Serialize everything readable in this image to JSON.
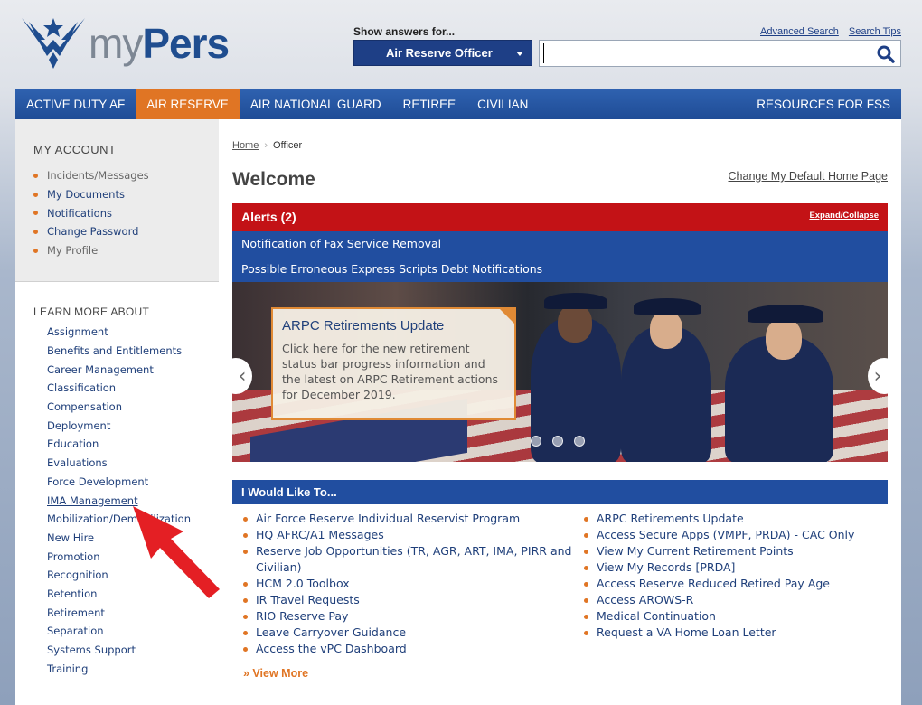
{
  "header": {
    "logo_my": "my",
    "logo_pers": "Pers",
    "show_answers_label": "Show answers for...",
    "role_selected": "Air Reserve Officer",
    "search_value": "",
    "links": [
      "Advanced Search",
      "Search Tips"
    ]
  },
  "nav": {
    "items": [
      "ACTIVE DUTY AF",
      "AIR RESERVE",
      "AIR NATIONAL GUARD",
      "RETIREE",
      "CIVILIAN"
    ],
    "active": "AIR RESERVE",
    "right_item": "RESOURCES FOR FSS",
    "active_color": "#e07524"
  },
  "sidebar": {
    "account_title": "MY ACCOUNT",
    "account_items": [
      "Incidents/Messages",
      "My Documents",
      "Notifications",
      "Change Password",
      "My Profile"
    ],
    "learn_title": "LEARN MORE ABOUT",
    "learn_items": [
      "Assignment",
      "Benefits and Entitlements",
      "Career Management",
      "Classification",
      "Compensation",
      "Deployment",
      "Education",
      "Evaluations",
      "Force Development",
      "IMA Management",
      "Mobilization/Demobilization",
      "New Hire",
      "Promotion",
      "Recognition",
      "Retention",
      "Retirement",
      "Separation",
      "Systems Support",
      "Training"
    ]
  },
  "main": {
    "breadcrumb_home": "Home",
    "breadcrumb_current": "Officer",
    "title": "Welcome",
    "change_home": "Change My Default Home Page",
    "alerts_title": "Alerts (2)",
    "alerts_toggle": "Expand/Collapse",
    "alerts": [
      "Notification of Fax Service Removal",
      "Possible Erroneous Express Scripts Debt Notifications"
    ],
    "carousel": {
      "title": "ARPC Retirements  Update",
      "body": "Click here for the new retirement status bar progress information and the latest on ARPC Retirement actions for December 2019.",
      "prev_icon": "chevron-left-icon",
      "next_icon": "chevron-right-icon",
      "dots": 3
    },
    "iwlt_title": "I Would Like To...",
    "iwlt_left": [
      "Air Force Reserve Individual Reservist Program",
      "HQ AFRC/A1 Messages",
      "Reserve Job Opportunities (TR, AGR, ART, IMA, PIRR and Civilian)",
      "HCM 2.0 Toolbox",
      "IR Travel Requests",
      "RIO Reserve Pay",
      "Leave Carryover Guidance",
      "Access the vPC Dashboard"
    ],
    "iwlt_right": [
      "ARPC Retirements Update",
      "Access Secure Apps (VMPF, PRDA) - CAC Only",
      "View My Current Retirement Points",
      "View My Records [PRDA]",
      "Access Reserve Reduced Retired Pay Age",
      "Access AROWS-R",
      "Medical Continuation",
      "Request a VA Home Loan Letter"
    ],
    "view_more": "» View More"
  },
  "colors": {
    "brand_blue": "#1f4d8f",
    "nav_blue": "#214ea0",
    "alert_red": "#c31216",
    "accent_orange": "#e07524"
  }
}
